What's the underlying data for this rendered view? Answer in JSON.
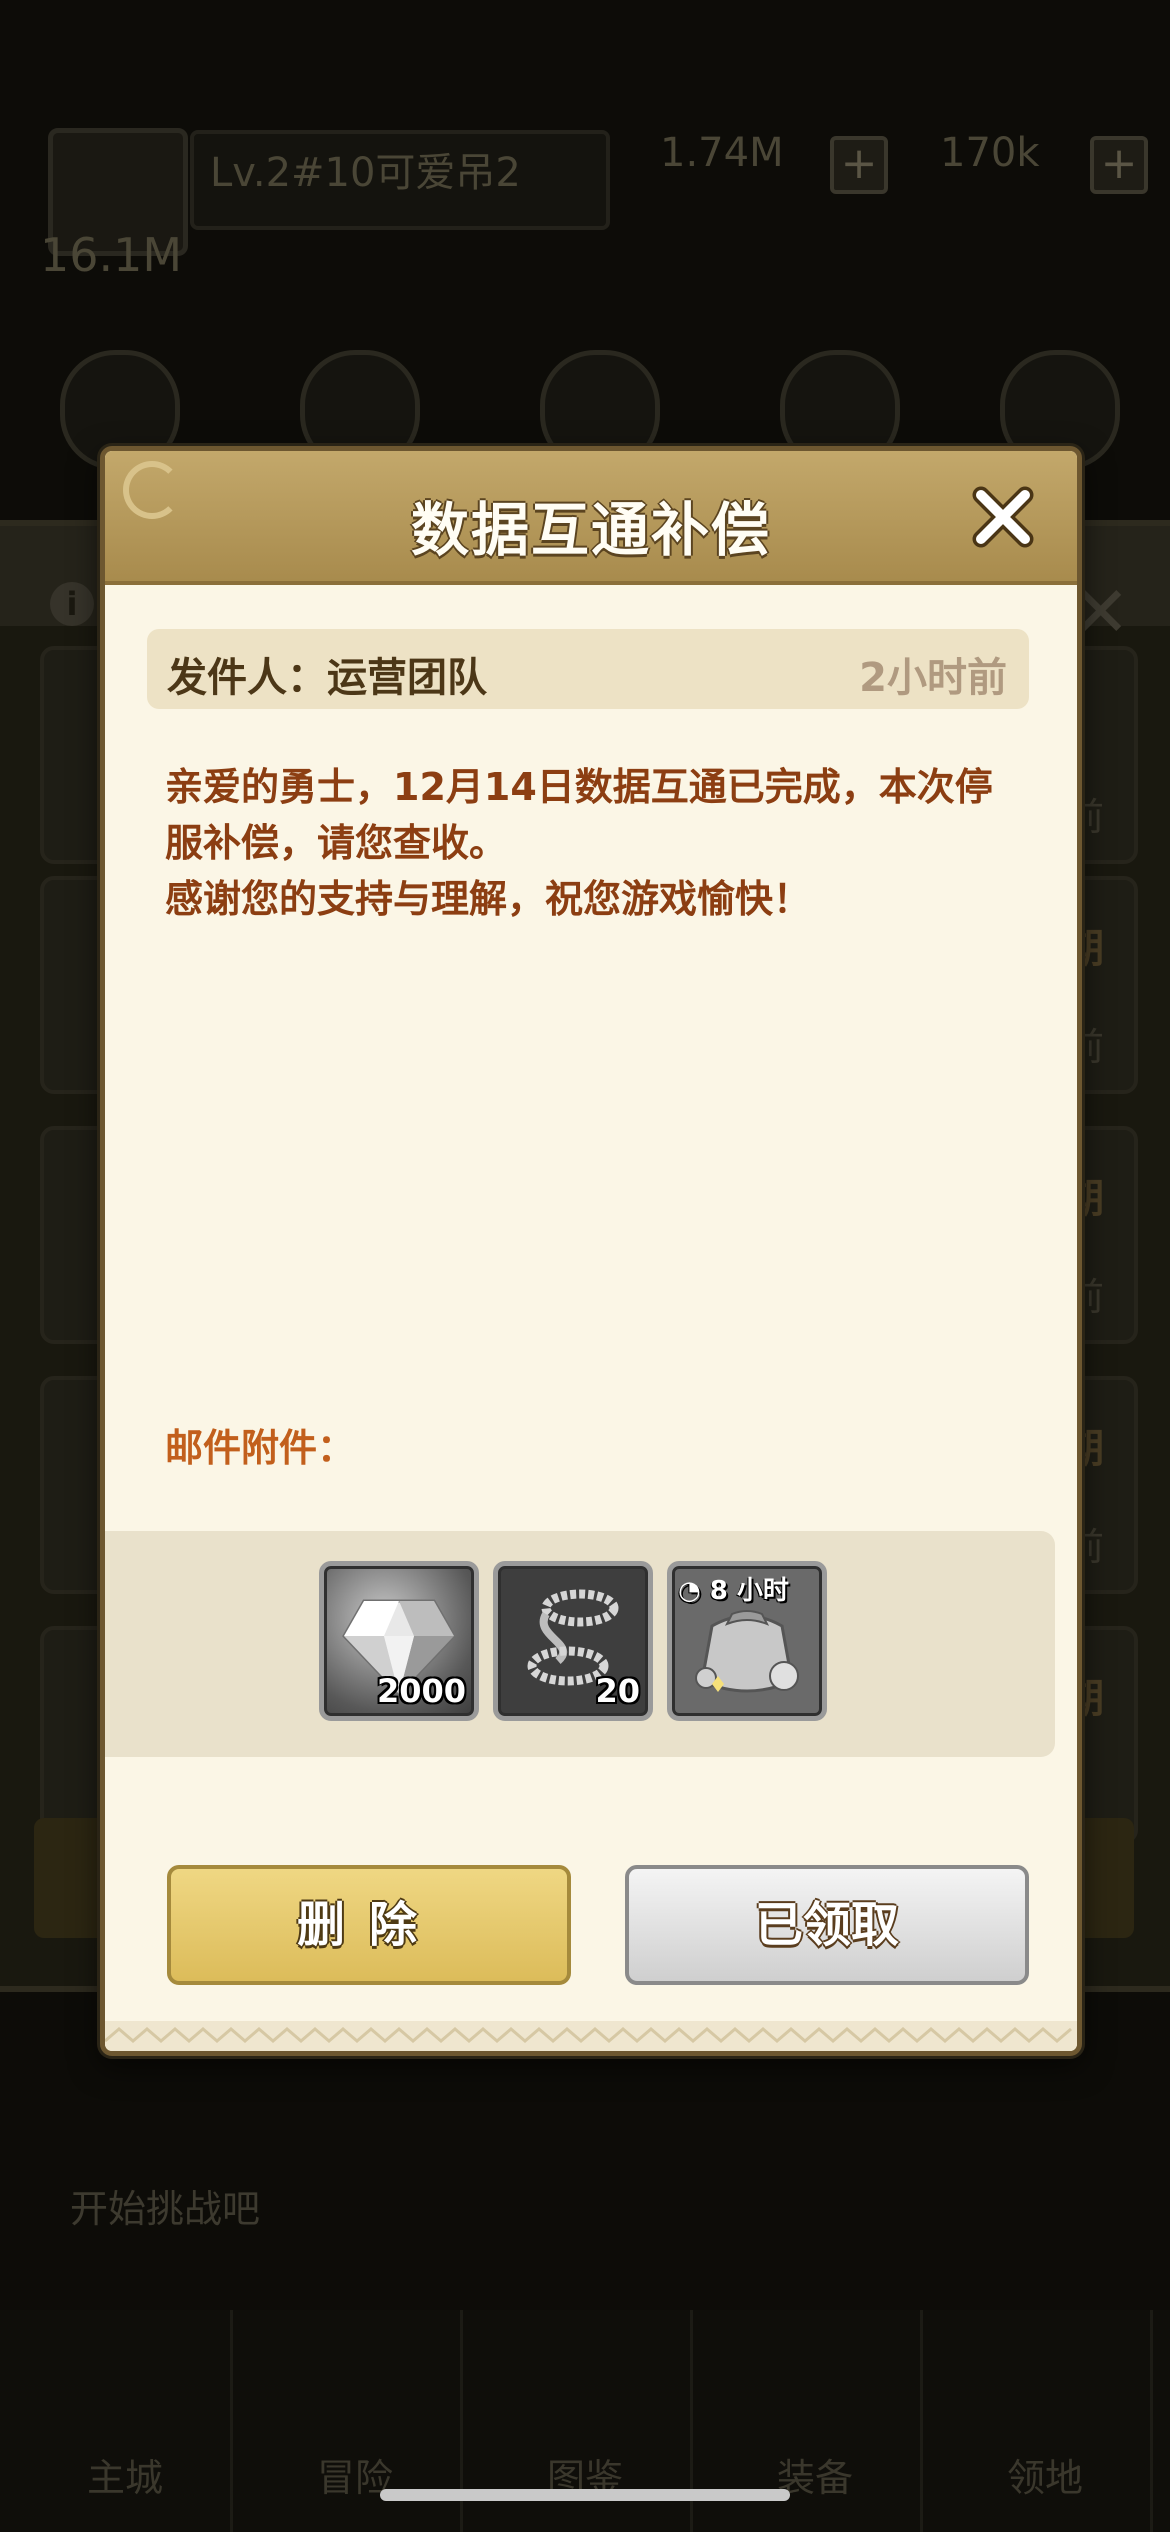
{
  "background": {
    "player_name": "Lv.2#10可爱吊2",
    "resource_1": "1.74M",
    "resource_2": "170k",
    "power": "16.1M",
    "chat_preview": "开始挑战吧",
    "list_dates": [
      "前",
      "期",
      "前",
      "期",
      "前",
      "期",
      "前",
      "期"
    ],
    "tabs": [
      "主城",
      "冒险",
      "图鉴",
      "装备",
      "领地"
    ]
  },
  "dialog": {
    "title": "数据互通补偿",
    "sender_label": "发件人：运营团队",
    "sender_time": "2小时前",
    "body_lines": [
      "亲爱的勇士，12月14日数据互通已完成，本次停",
      "服补偿，请您查收。",
      "感谢您的支持与理解，祝您游戏愉快！"
    ],
    "attachments_label": "邮件附件：",
    "attachments": [
      {
        "name": "diamond-icon",
        "qty": "2000"
      },
      {
        "name": "rope-ring-icon",
        "qty": "20"
      },
      {
        "name": "supply-bag-icon",
        "timer": "8 小时"
      }
    ],
    "delete_label": "删除",
    "claimed_label": "已领取"
  }
}
